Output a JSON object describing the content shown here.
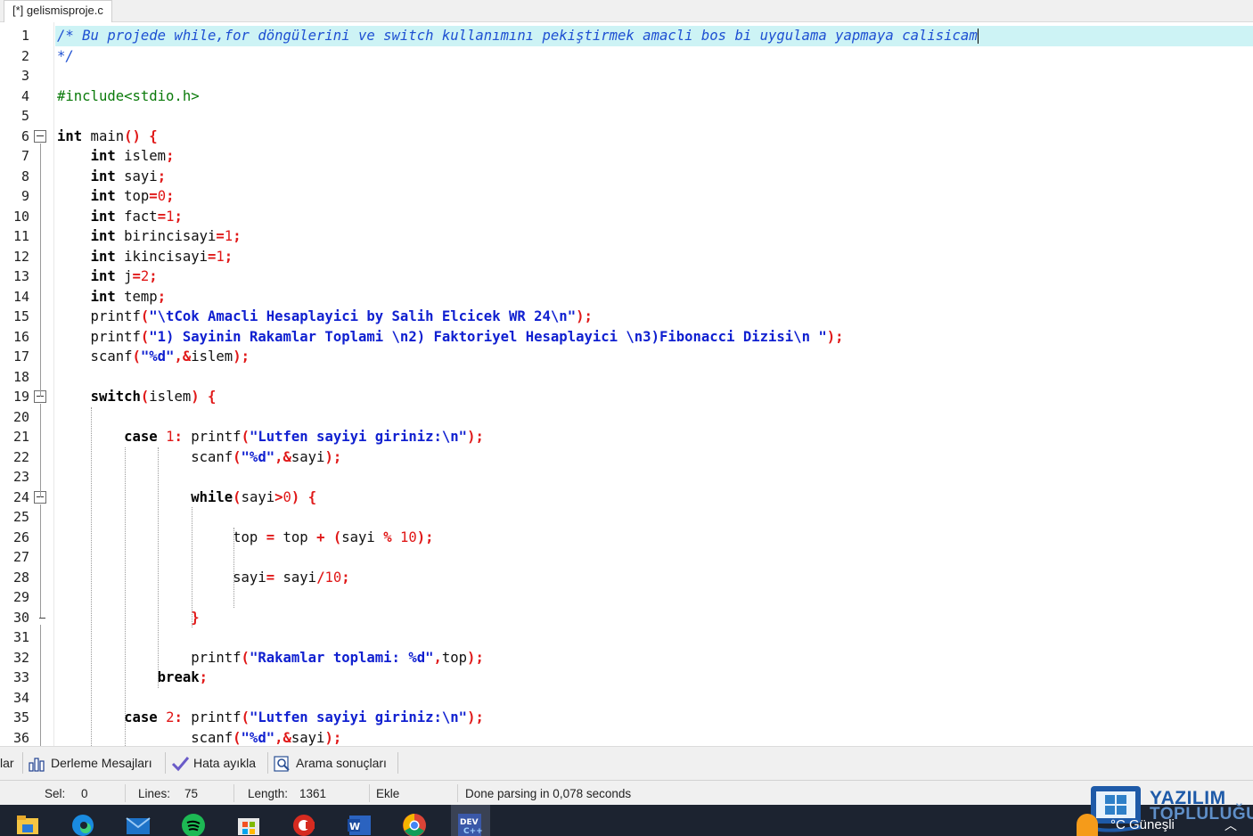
{
  "tab": {
    "title": "[*] gelismisproje.c"
  },
  "editor": {
    "line_numbers": [
      "1",
      "2",
      "3",
      "4",
      "5",
      "6",
      "7",
      "8",
      "9",
      "10",
      "11",
      "12",
      "13",
      "14",
      "15",
      "16",
      "17",
      "18",
      "19",
      "20",
      "21",
      "22",
      "23",
      "24",
      "25",
      "26",
      "27",
      "28",
      "29",
      "30",
      "31",
      "32",
      "33",
      "34",
      "35",
      "36"
    ],
    "lines": [
      "/* Bu projede while,for döngülerini ve switch kullanımını pekiştirmek amacli bos bi uygulama yapmaya calisicam",
      "*/",
      "",
      "#include<stdio.h>",
      "",
      "int main() {",
      "    int islem;",
      "    int sayi;",
      "    int top=0;",
      "    int fact=1;",
      "    int birincisayi=1;",
      "    int ikincisayi=1;",
      "    int j=2;",
      "    int temp;",
      "    printf(\"\\tCok Amacli Hesaplayici by Salih Elcicek WR 24\\n\");",
      "    printf(\"1) Sayinin Rakamlar Toplami \\n2) Faktoriyel Hesaplayici \\n3)Fibonacci Dizisi\\n \");",
      "    scanf(\"%d\",&islem);",
      "",
      "    switch(islem) {",
      "",
      "        case 1: printf(\"Lutfen sayiyi giriniz:\\n\");",
      "                scanf(\"%d\",&sayi);",
      "",
      "                while(sayi>0) {",
      "",
      "                     top = top + (sayi % 10);",
      "",
      "                     sayi= sayi/10;",
      "",
      "                }",
      "",
      "                printf(\"Rakamlar toplami: %d\",top);",
      "            break;",
      "",
      "        case 2: printf(\"Lutfen sayiyi giriniz:\\n\");",
      "                scanf(\"%d\",&sayi);"
    ]
  },
  "bottom_tabs": {
    "partial": "lar",
    "compile_messages": "Derleme Mesajları",
    "debug": "Hata ayıkla",
    "search_results": "Arama sonuçları"
  },
  "status": {
    "sel_label": "Sel:",
    "sel_value": "0",
    "lines_label": "Lines:",
    "lines_value": "75",
    "length_label": "Length:",
    "length_value": "1361",
    "mode": "Ekle",
    "message": "Done parsing in 0,078 seconds"
  },
  "watermark": {
    "line1": "YAZILIM",
    "line2": "TOPLULUĞU"
  },
  "taskbar": {
    "weather_text": "°C  Güneşli",
    "icons": [
      "file-explorer-icon",
      "edge-icon",
      "mail-icon",
      "spotify-icon",
      "store-icon",
      "ccleaner-icon",
      "word-icon",
      "chrome-icon",
      "devcpp-icon"
    ]
  },
  "colors": {
    "active_line": "#cdf3f5",
    "comment": "#1e50d2",
    "string": "#1020d0",
    "number": "#e01818",
    "preprocessor": "#0a7a0a",
    "taskbar": "#1c2330"
  }
}
